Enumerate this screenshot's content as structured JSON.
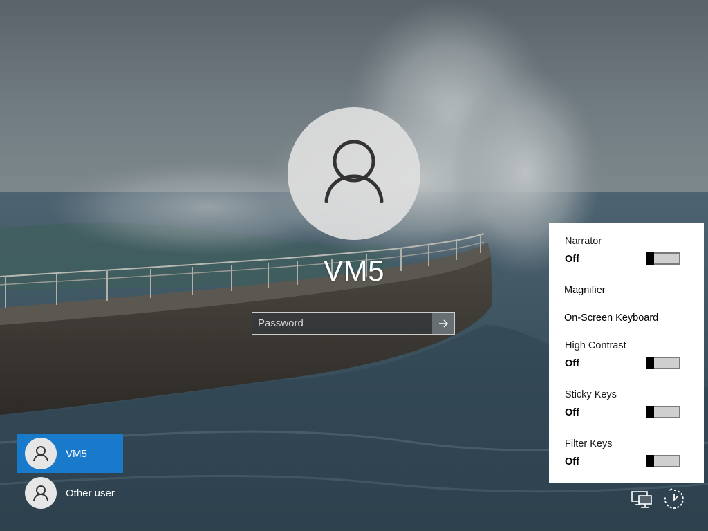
{
  "login": {
    "username": "VM5",
    "password_placeholder": "Password"
  },
  "users": [
    {
      "name": "VM5",
      "selected": true
    },
    {
      "name": "Other user",
      "selected": false
    }
  ],
  "ease_of_access": {
    "narrator": {
      "label": "Narrator",
      "state": "Off"
    },
    "magnifier": {
      "label": "Magnifier"
    },
    "osk": {
      "label": "On-Screen Keyboard"
    },
    "high_contrast": {
      "label": "High Contrast",
      "state": "Off"
    },
    "sticky_keys": {
      "label": "Sticky Keys",
      "state": "Off"
    },
    "filter_keys": {
      "label": "Filter Keys",
      "state": "Off"
    }
  },
  "system_icons": [
    "network-icon",
    "ease-of-access-icon"
  ],
  "colors": {
    "selected_user": "#1979ca",
    "panel_bg": "#ffffff"
  }
}
